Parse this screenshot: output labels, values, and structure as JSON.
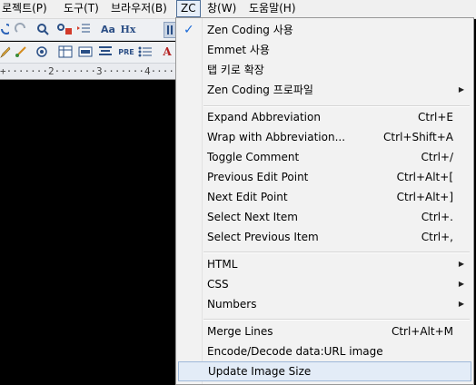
{
  "menubar": {
    "items": [
      {
        "label": "로젝트(P)"
      },
      {
        "label": "도구(T)"
      },
      {
        "label": "브라우저(B)"
      },
      {
        "label": "ZC"
      },
      {
        "label": "창(W)"
      },
      {
        "label": "도움말(H)"
      }
    ]
  },
  "toolbar_row1": [
    "refresh-icon",
    "redo-icon",
    "find-icon",
    "find-replace-icon",
    "indent-list-icon",
    "font-size-icon",
    "heading-icon",
    "zen-coding-icon"
  ],
  "toolbar_row1_text": {
    "aa": "Aa",
    "hx": "Hx"
  },
  "toolbar_row2": [
    "pencil-icon",
    "brush-icon",
    "layers-icon",
    "table-icon",
    "form-icon",
    "align-icon",
    "pre-icon",
    "list-icon",
    "text-color-icon"
  ],
  "toolbar_row2_text": {
    "pre": "PRE",
    "a": "A"
  },
  "ruler": {
    "text": "+·······2·······3·······4·····"
  },
  "menu": {
    "items": [
      {
        "label": "Zen Coding 사용",
        "checked": true
      },
      {
        "label": "Emmet 사용"
      },
      {
        "label": "탭 키로 확장"
      },
      {
        "label": "Zen Coding 프로파일",
        "submenu": true
      },
      {
        "label": "Expand Abbreviation",
        "shortcut": "Ctrl+E"
      },
      {
        "label": "Wrap with Abbreviation...",
        "shortcut": "Ctrl+Shift+A"
      },
      {
        "label": "Toggle Comment",
        "shortcut": "Ctrl+/"
      },
      {
        "label": "Previous Edit Point",
        "shortcut": "Ctrl+Alt+["
      },
      {
        "label": "Next Edit Point",
        "shortcut": "Ctrl+Alt+]"
      },
      {
        "label": "Select Next Item",
        "shortcut": "Ctrl+."
      },
      {
        "label": "Select Previous Item",
        "shortcut": "Ctrl+,"
      },
      {
        "label": "HTML",
        "submenu": true
      },
      {
        "label": "CSS",
        "submenu": true
      },
      {
        "label": "Numbers",
        "submenu": true
      },
      {
        "label": "Merge Lines",
        "shortcut": "Ctrl+Alt+M"
      },
      {
        "label": "Encode/Decode data:URL image"
      },
      {
        "label": "Update Image Size",
        "highlighted": true
      }
    ],
    "check_glyph": "✓",
    "arrow_glyph": "▶"
  }
}
